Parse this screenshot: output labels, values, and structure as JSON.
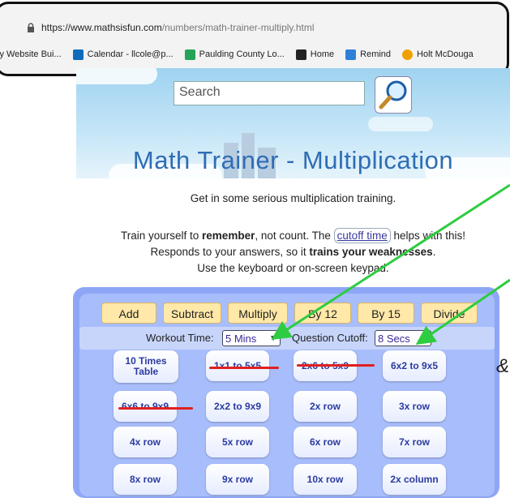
{
  "browser": {
    "url_host": "https://www.mathsisfun.com",
    "url_path": "/numbers/math-trainer-multiply.html",
    "bookmarks": [
      {
        "label": "ly Website Bui...",
        "icon": "document-icon",
        "color": "#888888"
      },
      {
        "label": "Calendar - llcole@p...",
        "icon": "outlook-icon",
        "color": "#0f6cbd"
      },
      {
        "label": "Paulding County Lo...",
        "icon": "classroom-icon",
        "color": "#23a456"
      },
      {
        "label": "Home",
        "icon": "home-icon",
        "color": "#222222"
      },
      {
        "label": "Remind",
        "icon": "remind-icon",
        "color": "#2f7fd8"
      },
      {
        "label": "Holt McDouga",
        "icon": "holt-icon",
        "color": "#f0a000"
      }
    ]
  },
  "header": {
    "search_placeholder": "Search",
    "title": "Math Trainer - Multiplication"
  },
  "intro": {
    "line1": "Get in some serious multiplication training.",
    "line2_pre": "Train yourself to ",
    "line2_bold": "remember",
    "line2_mid": ", not count. The ",
    "line2_link": "cutoff time",
    "line2_post": " helps with this!",
    "line3_pre": "Responds to your answers, so it ",
    "line3_bold": "trains your weaknesses",
    "line3_post": ".",
    "line4": "Use the keyboard or on-screen keypad."
  },
  "tabs": [
    "Add",
    "Subtract",
    "Multiply",
    "By 12",
    "By 15",
    "Divide"
  ],
  "settings": {
    "workout_label": "Workout Time:",
    "workout_value": "5 Mins",
    "cutoff_label": "Question Cutoff:",
    "cutoff_value": "8 Secs"
  },
  "buttons": [
    [
      "10 Times Table",
      "1x1 to 5x5",
      "2x6 to 5x9",
      "6x2 to 9x5"
    ],
    [
      "6x6 to 9x9",
      "2x2 to 9x9",
      "2x row",
      "3x row"
    ],
    [
      "4x row",
      "5x row",
      "6x row",
      "7x row"
    ],
    [
      "8x row",
      "9x row",
      "10x row",
      "2x column"
    ]
  ],
  "side_glyph": "&",
  "colors": {
    "arrow": "#2ecc40",
    "underline": "#e02020",
    "title": "#2f6db5"
  }
}
